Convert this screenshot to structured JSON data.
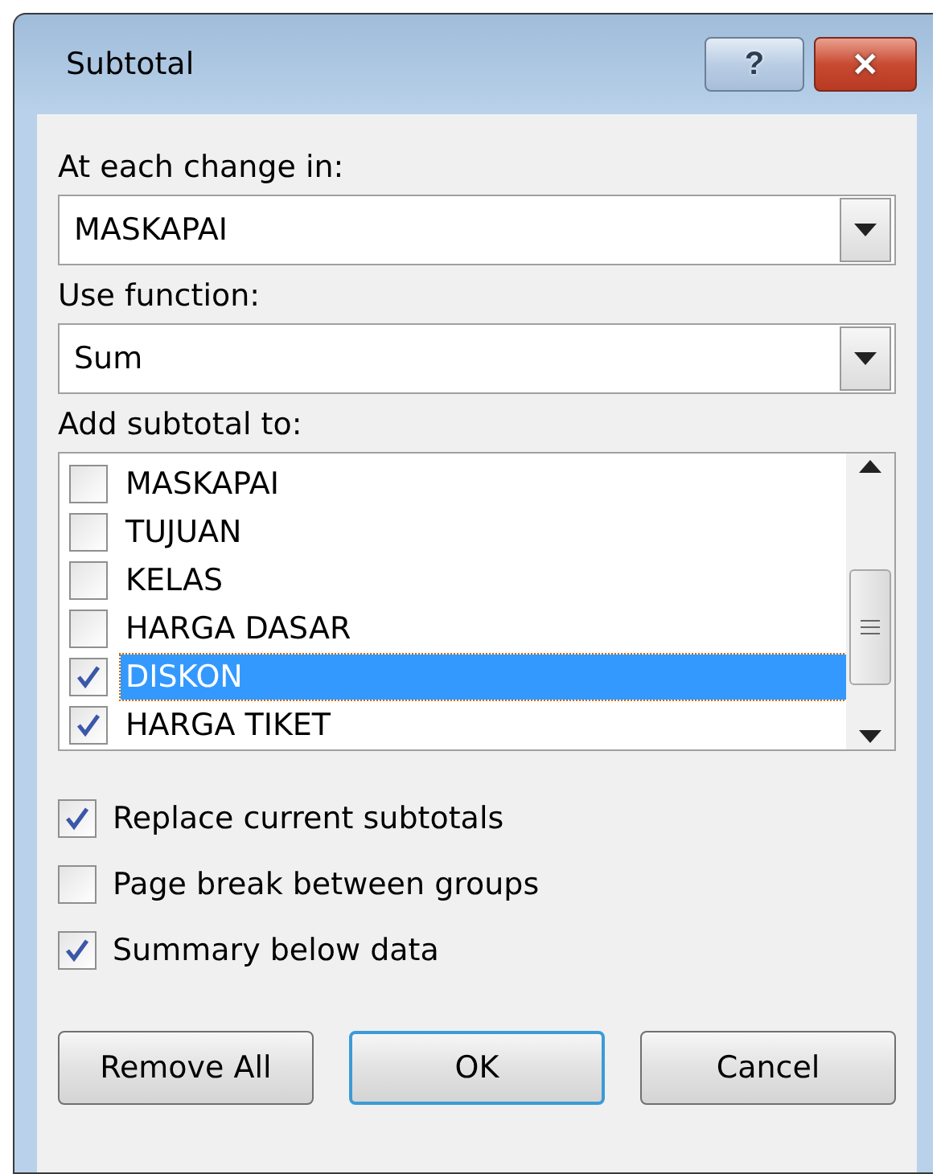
{
  "window": {
    "title": "Subtotal",
    "help_button": "?",
    "close_button": "✕"
  },
  "change_field": {
    "label": "At each change in:",
    "value": "MASKAPAI"
  },
  "function_field": {
    "label": "Use function:",
    "value": "Sum"
  },
  "subtotal_list": {
    "label": "Add subtotal to:",
    "items": [
      {
        "label": "MASKAPAI",
        "checked": false,
        "selected": false
      },
      {
        "label": "TUJUAN",
        "checked": false,
        "selected": false
      },
      {
        "label": "KELAS",
        "checked": false,
        "selected": false
      },
      {
        "label": "HARGA DASAR",
        "checked": false,
        "selected": false
      },
      {
        "label": "DISKON",
        "checked": true,
        "selected": true
      },
      {
        "label": "HARGA TIKET",
        "checked": true,
        "selected": false
      }
    ]
  },
  "options": [
    {
      "label": "Replace current subtotals",
      "checked": true
    },
    {
      "label": "Page break between groups",
      "checked": false
    },
    {
      "label": "Summary below data",
      "checked": true
    }
  ],
  "buttons": [
    {
      "label": "Remove All",
      "default": false
    },
    {
      "label": "OK",
      "default": true
    },
    {
      "label": "Cancel",
      "default": false
    }
  ]
}
